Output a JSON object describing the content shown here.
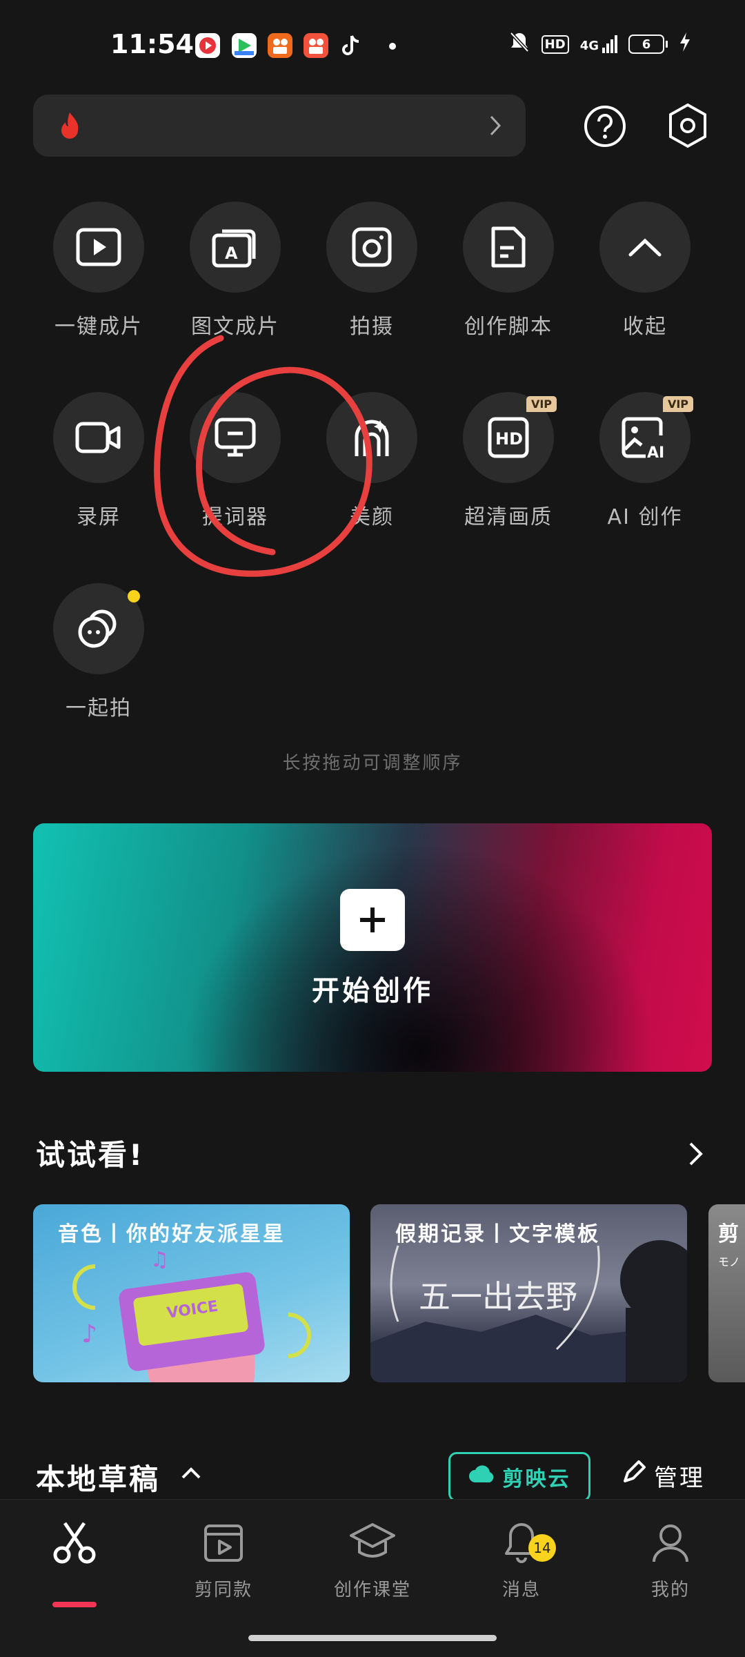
{
  "status_bar": {
    "time": "11:54",
    "network": "4G",
    "hd": "HD",
    "battery": "6",
    "app_icons": [
      "red-play-app-icon",
      "green-video-app-icon",
      "orange-app-icon",
      "pink-app-icon",
      "tiktok-icon"
    ],
    "icon_colors": [
      "#e8323c",
      "#2bbf5a",
      "#f06a1d",
      "#f2523b",
      "#ffffff"
    ]
  },
  "top_bar": {
    "search_icon": "flame-icon",
    "help_icon": "question-circle-icon",
    "settings_icon": "hexagon-settings-icon"
  },
  "tools": [
    {
      "label": "一键成片",
      "icon": "play-square-icon"
    },
    {
      "label": "图文成片",
      "icon": "text-to-video-icon"
    },
    {
      "label": "拍摄",
      "icon": "camera-icon"
    },
    {
      "label": "创作脚本",
      "icon": "script-document-icon"
    },
    {
      "label": "收起",
      "icon": "chevron-up-icon"
    },
    {
      "label": "录屏",
      "icon": "video-camera-icon"
    },
    {
      "label": "提词器",
      "icon": "teleprompter-icon"
    },
    {
      "label": "美颜",
      "icon": "beauty-icon"
    },
    {
      "label": "超清画质",
      "icon": "hd-icon",
      "vip": "VIP",
      "hd_text": "HD"
    },
    {
      "label": "AI 创作",
      "icon": "ai-image-icon",
      "vip": "VIP",
      "ai_text": "AI"
    },
    {
      "label": "一起拍",
      "icon": "shoot-together-icon"
    }
  ],
  "hint": "长按拖动可调整顺序",
  "create": {
    "label": "开始创作"
  },
  "try": {
    "title": "试试看!",
    "cards": [
      {
        "title": "音色丨你的好友派星星",
        "art_text": "VOICE"
      },
      {
        "title": "假期记录丨文字模板",
        "art_text": "五一出去野"
      },
      {
        "title": "剪",
        "art_text": "モノ"
      }
    ]
  },
  "drafts": {
    "title": "本地草稿",
    "cloud_label": "剪映云",
    "manage_label": "管理"
  },
  "nav": [
    {
      "label": "",
      "icon": "scissors-icon",
      "active": true
    },
    {
      "label": "剪同款",
      "icon": "template-video-icon"
    },
    {
      "label": "创作课堂",
      "icon": "graduation-cap-icon"
    },
    {
      "label": "消息",
      "icon": "bell-icon",
      "badge": "14"
    },
    {
      "label": "我的",
      "icon": "user-icon"
    }
  ],
  "colors": {
    "accent": "#2fd1b5",
    "active_underline": "#f23455",
    "badge": "#f8d21c",
    "annotation": "#e8403f"
  }
}
